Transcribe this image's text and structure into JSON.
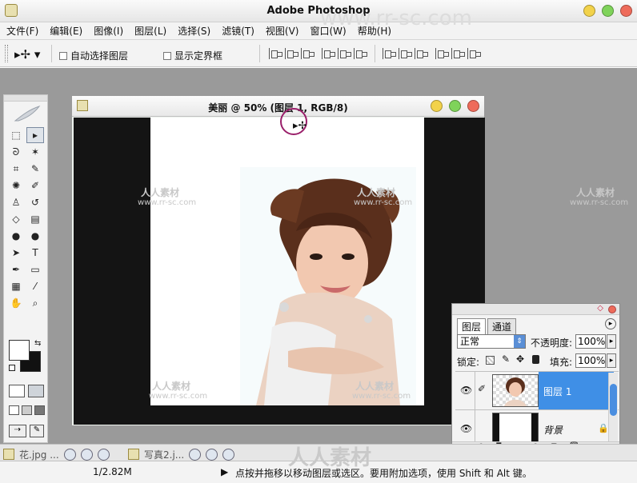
{
  "app": {
    "title": "Adobe Photoshop"
  },
  "menu": [
    "文件(F)",
    "编辑(E)",
    "图像(I)",
    "图层(L)",
    "选择(S)",
    "滤镜(T)",
    "视图(V)",
    "窗口(W)",
    "帮助(H)"
  ],
  "options": {
    "auto_select": "自动选择图层",
    "show_bounds": "显示定界框"
  },
  "document": {
    "title": "美丽 @ 50% (图层 1, RGB/8)"
  },
  "layers_panel": {
    "tabs": [
      "图层",
      "通道"
    ],
    "blend_mode": "正常",
    "opacity_label": "不透明度:",
    "opacity_value": "100%",
    "lock_label": "锁定:",
    "fill_label": "填充:",
    "fill_value": "100%",
    "layers": [
      {
        "name": "图层 1",
        "selected": true
      },
      {
        "name": "背景",
        "selected": false
      }
    ]
  },
  "taskbar": {
    "items": [
      "花.jpg ...",
      "写真2.j..."
    ]
  },
  "status": {
    "doc_size": "1/2.82M",
    "hint": "点按并拖移以移动图层或选区。要用附加选项，使用 Shift 和 Alt 键。"
  },
  "watermark": {
    "site": "www.rr-sc.com",
    "brand": "人人素材"
  },
  "colors": {
    "accent": "#3f8fe6",
    "canvas_bg": "#141414",
    "workspace": "#9a9a9a"
  }
}
